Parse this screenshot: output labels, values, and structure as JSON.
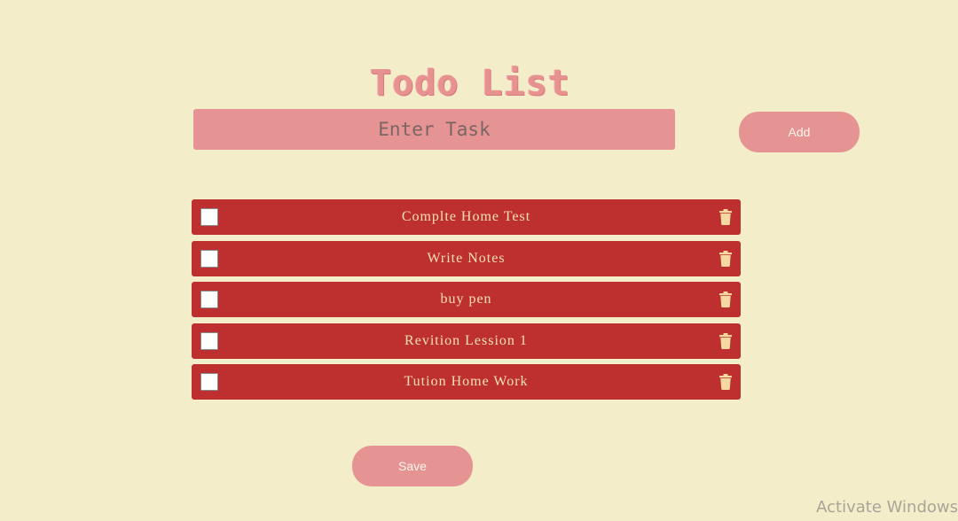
{
  "app": {
    "title": "Todo List"
  },
  "form": {
    "task_placeholder": "Enter Task",
    "task_value": "",
    "add_label": "Add"
  },
  "tasks": [
    {
      "label": "Complte Home Test",
      "checked": false
    },
    {
      "label": "Write Notes",
      "checked": false
    },
    {
      "label": "buy pen",
      "checked": false
    },
    {
      "label": "Revition Lession 1",
      "checked": false
    },
    {
      "label": "Tution Home Work",
      "checked": false
    }
  ],
  "footer": {
    "save_label": "Save"
  },
  "system": {
    "watermark": "Activate Windows"
  },
  "icons": {
    "delete": "trash-icon",
    "checkbox": "checkbox"
  },
  "colors": {
    "background": "#f3eec9",
    "accent": "#e59393",
    "item_bg": "#be2f2f",
    "item_text": "#f5e2b4"
  }
}
